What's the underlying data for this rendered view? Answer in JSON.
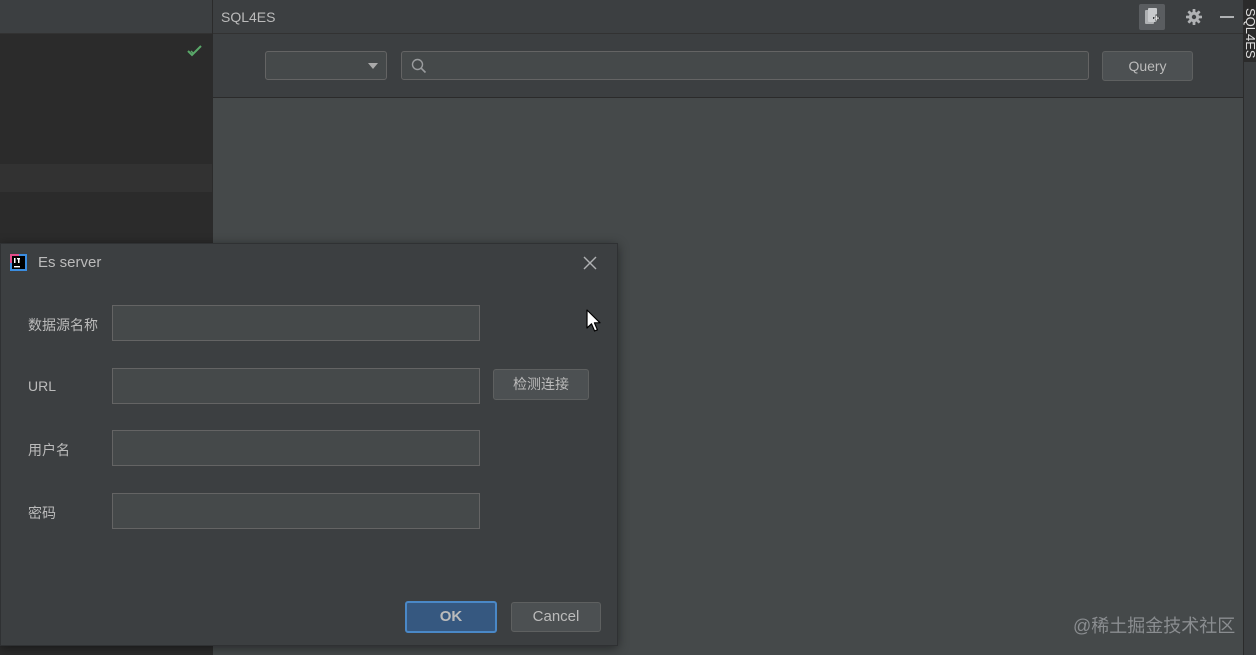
{
  "tool_window": {
    "title": "SQL4ES",
    "header_icons": [
      "add-datasource-icon",
      "gear-icon",
      "minimize-icon"
    ],
    "combo_value": "",
    "search_value": "",
    "search_placeholder": "",
    "query_label": "Query"
  },
  "right_stripe": {
    "label": "SQL4ES"
  },
  "dialog": {
    "title": "Es server",
    "fields": [
      {
        "label": "数据源名称",
        "value": ""
      },
      {
        "label": "URL",
        "value": ""
      },
      {
        "label": "用户名",
        "value": ""
      },
      {
        "label": "密码",
        "value": ""
      }
    ],
    "check_connection_label": "检测连接",
    "ok_label": "OK",
    "cancel_label": "Cancel"
  },
  "watermark": "@稀土掘金技术社区",
  "colors": {
    "accent": "#365880",
    "accent_border": "#4a88c7",
    "check_green": "#59a869",
    "panel": "#3c3f41",
    "content": "#45494a"
  }
}
